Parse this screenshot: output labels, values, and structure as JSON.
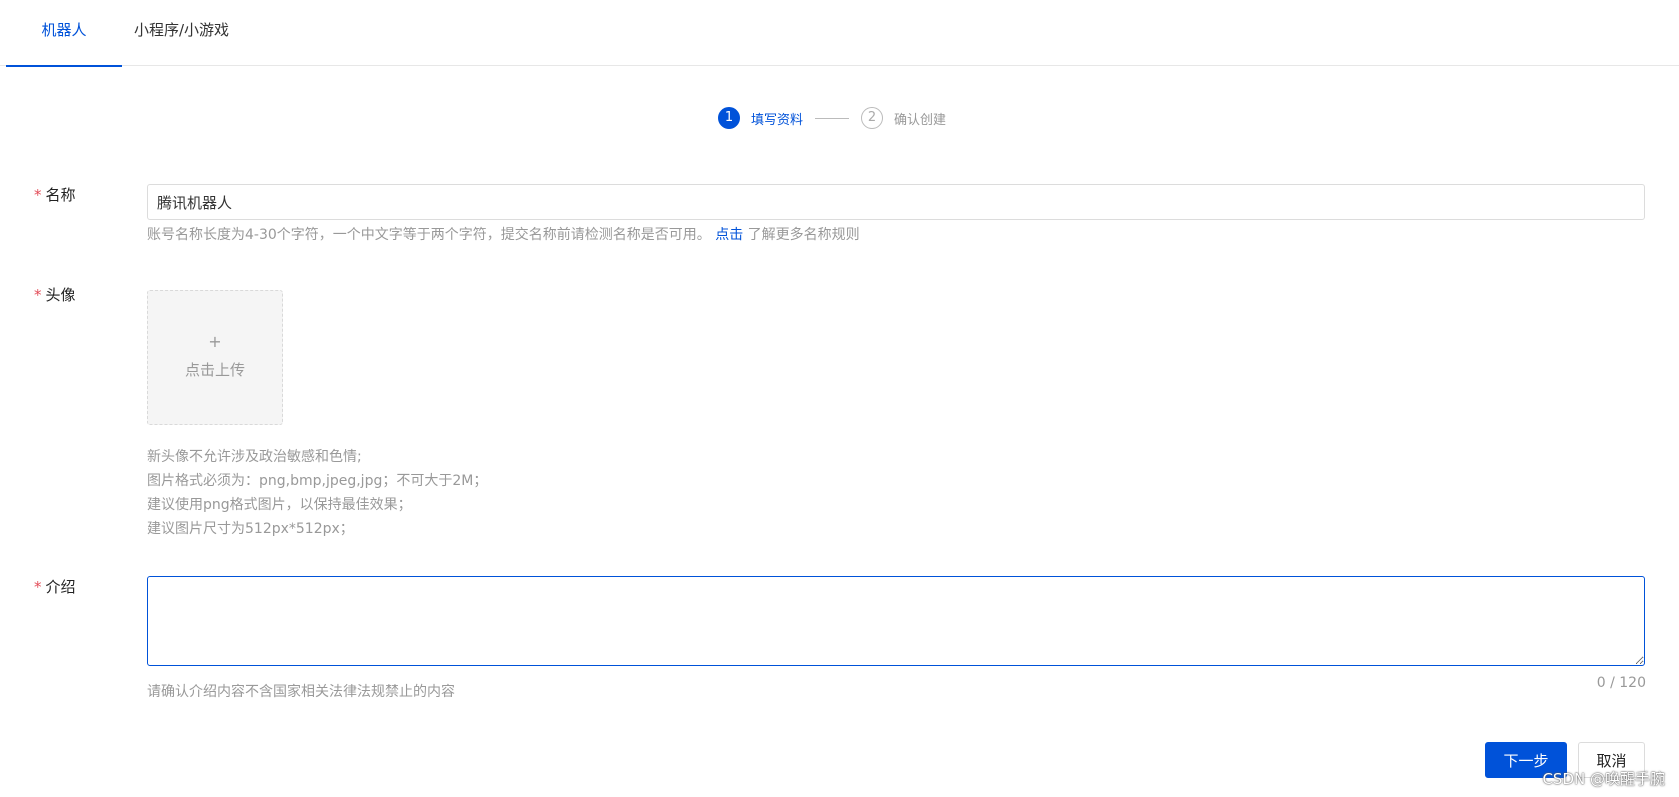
{
  "tabs": [
    {
      "label": "机器人",
      "active": true
    },
    {
      "label": "小程序/小游戏",
      "active": false
    }
  ],
  "steps": [
    {
      "number": "1",
      "label": "填写资料",
      "active": true
    },
    {
      "number": "2",
      "label": "确认创建",
      "active": false
    }
  ],
  "form": {
    "required_mark": "*",
    "name": {
      "label": "名称",
      "value": "腾讯机器人",
      "hint_text": "账号名称长度为4-30个字符，一个中文字等于两个字符，提交名称前请检测名称是否可用。",
      "hint_link": "点击",
      "hint_suffix": " 了解更多名称规则"
    },
    "avatar": {
      "label": "头像",
      "upload_plus": "+",
      "upload_text": "点击上传",
      "hints": [
        "新头像不允许涉及政治敏感和色情;",
        "图片格式必须为：png,bmp,jpeg,jpg；不可大于2M；",
        "建议使用png格式图片，以保持最佳效果；",
        "建议图片尺寸为512px*512px；"
      ]
    },
    "intro": {
      "label": "介绍",
      "value": "",
      "counter": "0 / 120",
      "hint": "请确认介绍内容不含国家相关法律法规禁止的内容"
    }
  },
  "buttons": {
    "next": "下一步",
    "cancel": "取消"
  },
  "watermark": "CSDN @唤醒手腕",
  "colors": {
    "primary": "#0052d9",
    "required": "#e34d59",
    "hint": "#999999"
  }
}
